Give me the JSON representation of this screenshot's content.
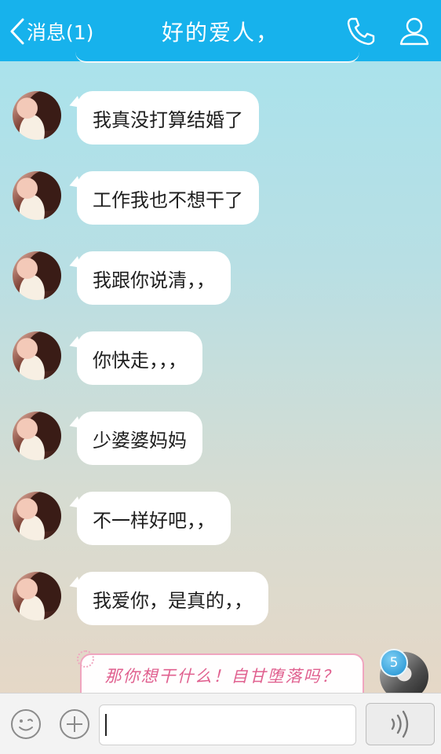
{
  "header": {
    "back_label": "消息(1)",
    "title": "好的爱人，",
    "call_icon": "phone-icon",
    "profile_icon": "person-icon"
  },
  "messages": [
    {
      "sender": "other",
      "text": "我真没打算结婚了"
    },
    {
      "sender": "other",
      "text": "工作我也不想干了"
    },
    {
      "sender": "other",
      "text": "我跟你说清，，"
    },
    {
      "sender": "other",
      "text": "你快走，，，"
    },
    {
      "sender": "other",
      "text": "少婆婆妈妈"
    },
    {
      "sender": "other",
      "text": "不一样好吧，，"
    },
    {
      "sender": "other",
      "text": "我爱你，是真的，，"
    }
  ],
  "my_message": {
    "text": "那你想干什么！自甘堕落吗？",
    "badge_count": "5"
  },
  "input_bar": {
    "emoji_icon": "emoji-icon",
    "plus_icon": "plus-icon",
    "input_value": "",
    "voice_icon": "voice-wave-icon"
  },
  "colors": {
    "header_bg": "#17b2ec",
    "bubble_bg": "#ffffff",
    "my_bubble_text": "#e0608f",
    "badge": "#1b8ed0"
  }
}
